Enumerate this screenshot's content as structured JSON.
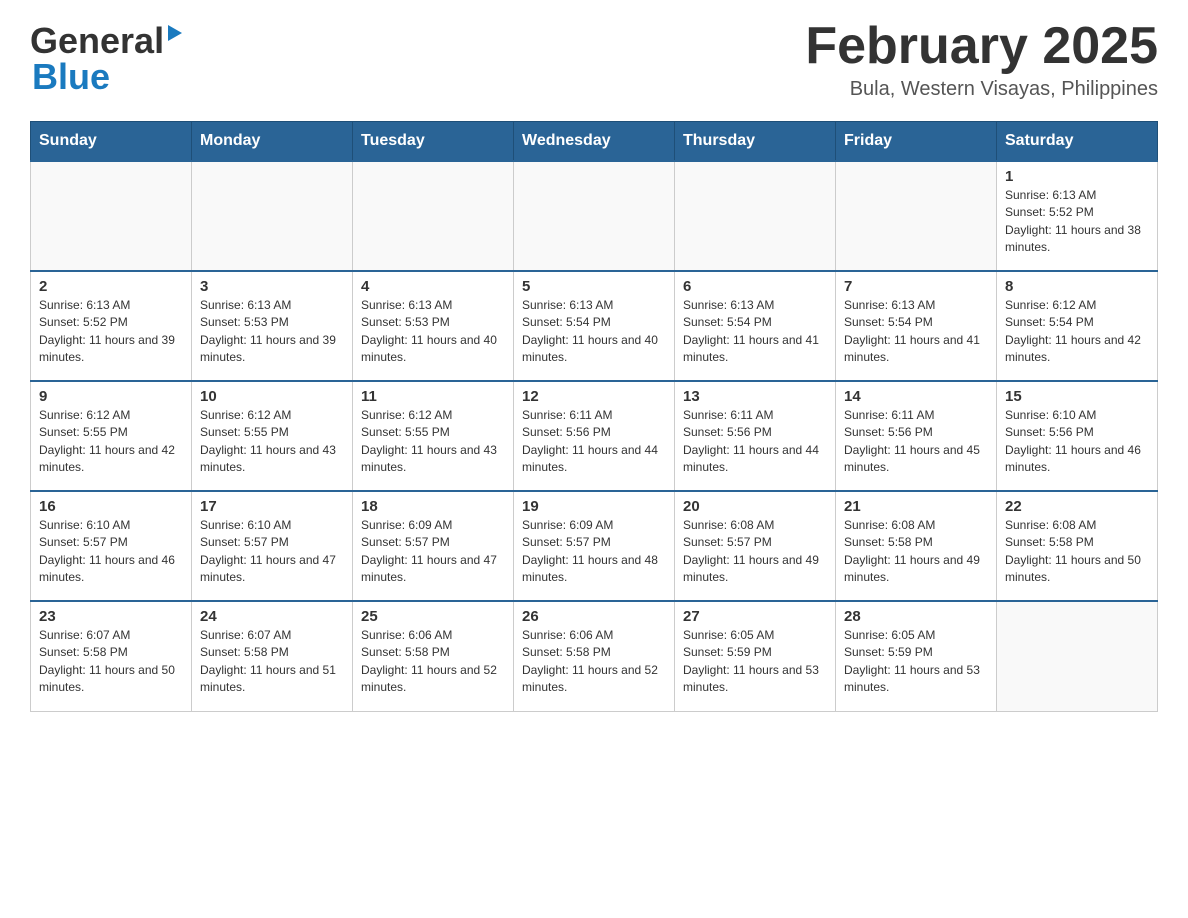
{
  "header": {
    "logo_general": "General",
    "logo_blue": "Blue",
    "month_title": "February 2025",
    "location": "Bula, Western Visayas, Philippines"
  },
  "days_of_week": [
    "Sunday",
    "Monday",
    "Tuesday",
    "Wednesday",
    "Thursday",
    "Friday",
    "Saturday"
  ],
  "weeks": [
    {
      "days": [
        {
          "num": "",
          "sunrise": "",
          "sunset": "",
          "daylight": ""
        },
        {
          "num": "",
          "sunrise": "",
          "sunset": "",
          "daylight": ""
        },
        {
          "num": "",
          "sunrise": "",
          "sunset": "",
          "daylight": ""
        },
        {
          "num": "",
          "sunrise": "",
          "sunset": "",
          "daylight": ""
        },
        {
          "num": "",
          "sunrise": "",
          "sunset": "",
          "daylight": ""
        },
        {
          "num": "",
          "sunrise": "",
          "sunset": "",
          "daylight": ""
        },
        {
          "num": "1",
          "sunrise": "Sunrise: 6:13 AM",
          "sunset": "Sunset: 5:52 PM",
          "daylight": "Daylight: 11 hours and 38 minutes."
        }
      ]
    },
    {
      "days": [
        {
          "num": "2",
          "sunrise": "Sunrise: 6:13 AM",
          "sunset": "Sunset: 5:52 PM",
          "daylight": "Daylight: 11 hours and 39 minutes."
        },
        {
          "num": "3",
          "sunrise": "Sunrise: 6:13 AM",
          "sunset": "Sunset: 5:53 PM",
          "daylight": "Daylight: 11 hours and 39 minutes."
        },
        {
          "num": "4",
          "sunrise": "Sunrise: 6:13 AM",
          "sunset": "Sunset: 5:53 PM",
          "daylight": "Daylight: 11 hours and 40 minutes."
        },
        {
          "num": "5",
          "sunrise": "Sunrise: 6:13 AM",
          "sunset": "Sunset: 5:54 PM",
          "daylight": "Daylight: 11 hours and 40 minutes."
        },
        {
          "num": "6",
          "sunrise": "Sunrise: 6:13 AM",
          "sunset": "Sunset: 5:54 PM",
          "daylight": "Daylight: 11 hours and 41 minutes."
        },
        {
          "num": "7",
          "sunrise": "Sunrise: 6:13 AM",
          "sunset": "Sunset: 5:54 PM",
          "daylight": "Daylight: 11 hours and 41 minutes."
        },
        {
          "num": "8",
          "sunrise": "Sunrise: 6:12 AM",
          "sunset": "Sunset: 5:54 PM",
          "daylight": "Daylight: 11 hours and 42 minutes."
        }
      ]
    },
    {
      "days": [
        {
          "num": "9",
          "sunrise": "Sunrise: 6:12 AM",
          "sunset": "Sunset: 5:55 PM",
          "daylight": "Daylight: 11 hours and 42 minutes."
        },
        {
          "num": "10",
          "sunrise": "Sunrise: 6:12 AM",
          "sunset": "Sunset: 5:55 PM",
          "daylight": "Daylight: 11 hours and 43 minutes."
        },
        {
          "num": "11",
          "sunrise": "Sunrise: 6:12 AM",
          "sunset": "Sunset: 5:55 PM",
          "daylight": "Daylight: 11 hours and 43 minutes."
        },
        {
          "num": "12",
          "sunrise": "Sunrise: 6:11 AM",
          "sunset": "Sunset: 5:56 PM",
          "daylight": "Daylight: 11 hours and 44 minutes."
        },
        {
          "num": "13",
          "sunrise": "Sunrise: 6:11 AM",
          "sunset": "Sunset: 5:56 PM",
          "daylight": "Daylight: 11 hours and 44 minutes."
        },
        {
          "num": "14",
          "sunrise": "Sunrise: 6:11 AM",
          "sunset": "Sunset: 5:56 PM",
          "daylight": "Daylight: 11 hours and 45 minutes."
        },
        {
          "num": "15",
          "sunrise": "Sunrise: 6:10 AM",
          "sunset": "Sunset: 5:56 PM",
          "daylight": "Daylight: 11 hours and 46 minutes."
        }
      ]
    },
    {
      "days": [
        {
          "num": "16",
          "sunrise": "Sunrise: 6:10 AM",
          "sunset": "Sunset: 5:57 PM",
          "daylight": "Daylight: 11 hours and 46 minutes."
        },
        {
          "num": "17",
          "sunrise": "Sunrise: 6:10 AM",
          "sunset": "Sunset: 5:57 PM",
          "daylight": "Daylight: 11 hours and 47 minutes."
        },
        {
          "num": "18",
          "sunrise": "Sunrise: 6:09 AM",
          "sunset": "Sunset: 5:57 PM",
          "daylight": "Daylight: 11 hours and 47 minutes."
        },
        {
          "num": "19",
          "sunrise": "Sunrise: 6:09 AM",
          "sunset": "Sunset: 5:57 PM",
          "daylight": "Daylight: 11 hours and 48 minutes."
        },
        {
          "num": "20",
          "sunrise": "Sunrise: 6:08 AM",
          "sunset": "Sunset: 5:57 PM",
          "daylight": "Daylight: 11 hours and 49 minutes."
        },
        {
          "num": "21",
          "sunrise": "Sunrise: 6:08 AM",
          "sunset": "Sunset: 5:58 PM",
          "daylight": "Daylight: 11 hours and 49 minutes."
        },
        {
          "num": "22",
          "sunrise": "Sunrise: 6:08 AM",
          "sunset": "Sunset: 5:58 PM",
          "daylight": "Daylight: 11 hours and 50 minutes."
        }
      ]
    },
    {
      "days": [
        {
          "num": "23",
          "sunrise": "Sunrise: 6:07 AM",
          "sunset": "Sunset: 5:58 PM",
          "daylight": "Daylight: 11 hours and 50 minutes."
        },
        {
          "num": "24",
          "sunrise": "Sunrise: 6:07 AM",
          "sunset": "Sunset: 5:58 PM",
          "daylight": "Daylight: 11 hours and 51 minutes."
        },
        {
          "num": "25",
          "sunrise": "Sunrise: 6:06 AM",
          "sunset": "Sunset: 5:58 PM",
          "daylight": "Daylight: 11 hours and 52 minutes."
        },
        {
          "num": "26",
          "sunrise": "Sunrise: 6:06 AM",
          "sunset": "Sunset: 5:58 PM",
          "daylight": "Daylight: 11 hours and 52 minutes."
        },
        {
          "num": "27",
          "sunrise": "Sunrise: 6:05 AM",
          "sunset": "Sunset: 5:59 PM",
          "daylight": "Daylight: 11 hours and 53 minutes."
        },
        {
          "num": "28",
          "sunrise": "Sunrise: 6:05 AM",
          "sunset": "Sunset: 5:59 PM",
          "daylight": "Daylight: 11 hours and 53 minutes."
        },
        {
          "num": "",
          "sunrise": "",
          "sunset": "",
          "daylight": ""
        }
      ]
    }
  ]
}
